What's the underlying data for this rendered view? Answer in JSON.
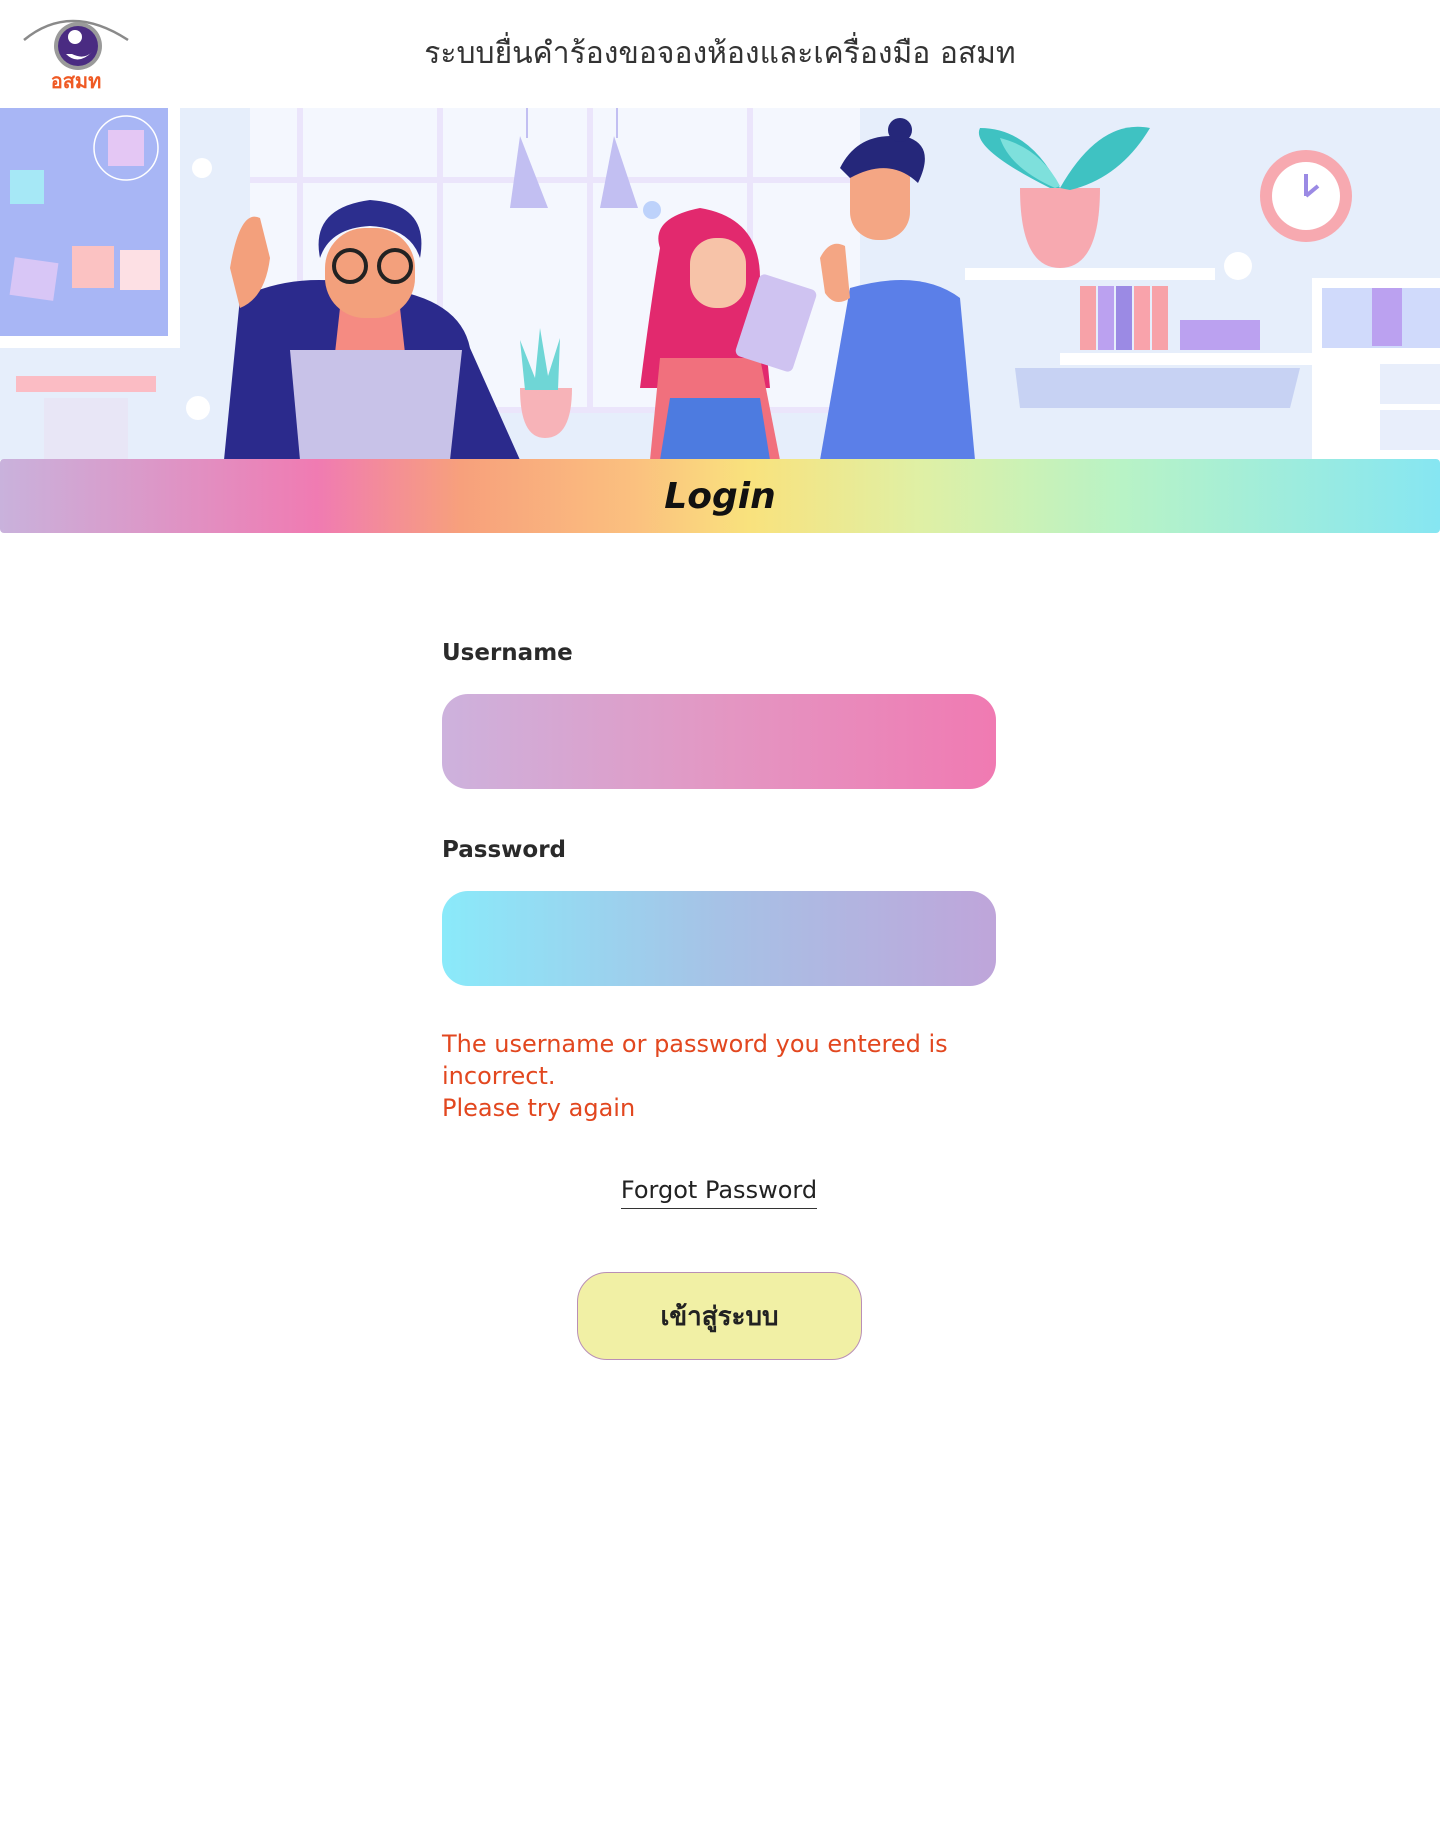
{
  "header": {
    "logo_text": "อสมท",
    "app_title": "ระบบยื่นคำร้องขอจองห้องและเครื่องมือ อสมท"
  },
  "banner": {
    "title": "Login"
  },
  "form": {
    "username_label": "Username",
    "username_value": "",
    "password_label": "Password",
    "password_value": "",
    "error_line1": "The username or password you entered is incorrect.",
    "error_line2": "Please try again",
    "forgot_password": "Forgot Password",
    "submit_label": "เข้าสู่ระบบ"
  },
  "colors": {
    "error": "#e2471f",
    "submit_bg": "#f1f0a5",
    "logo_orange": "#ef5a24",
    "logo_purple": "#4a2b82"
  }
}
